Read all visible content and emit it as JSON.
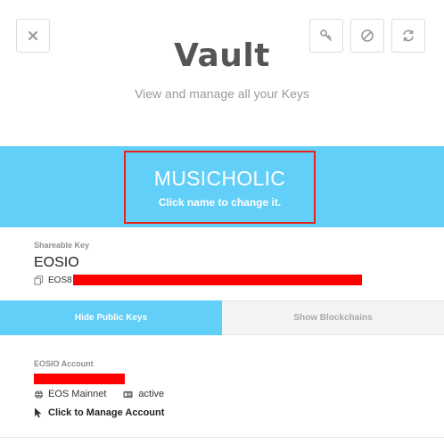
{
  "header": {
    "title": "Vault",
    "subtitle": "View and manage all your Keys"
  },
  "identity": {
    "name": "MUSICHOLIC",
    "hint": "Click name to change it."
  },
  "key": {
    "section_label": "Shareable Key",
    "name": "EOSIO",
    "public_key_prefix": "EOS8"
  },
  "tabs": [
    {
      "label": "Hide Public Keys",
      "active": true
    },
    {
      "label": "Show Blockchains",
      "active": false
    }
  ],
  "account": {
    "section_label": "EOSIO Account",
    "network": "EOS Mainnet",
    "permission": "active",
    "manage_label": "Click to Manage Account"
  },
  "colors": {
    "accent": "#62cff8",
    "highlight_border": "#e8231c",
    "redaction": "#ff0000"
  },
  "icons": [
    "close-icon",
    "key-icon",
    "block-icon",
    "refresh-icon",
    "copy-icon",
    "globe-icon",
    "id-card-icon",
    "cursor-icon"
  ]
}
